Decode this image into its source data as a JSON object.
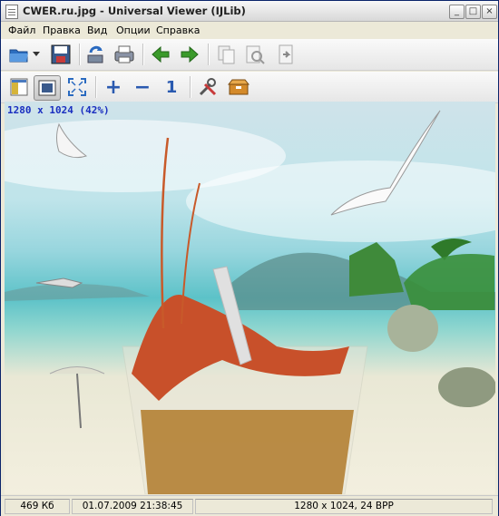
{
  "window": {
    "title": "CWER.ru.jpg - Universal Viewer (IJLib)"
  },
  "menu": [
    "Файл",
    "Правка",
    "Вид",
    "Опции",
    "Справка"
  ],
  "toolbar1": [
    "open-icon",
    "dropdown-arrow-icon",
    "save-icon",
    "reload-icon",
    "print-icon",
    "prev-icon",
    "next-icon",
    "copy-icon",
    "find-icon",
    "export-icon"
  ],
  "toolbar2": [
    "panel-icon",
    "fit-window-icon",
    "fullscreen-icon",
    "zoom-in-icon",
    "zoom-out-icon",
    "actual-size-icon",
    "settings-icon",
    "package-icon"
  ],
  "toolbar2_labels": {
    "zoom_in": "+",
    "zoom_out": "−",
    "actual": "1"
  },
  "viewport": {
    "image_info": "1280 x 1024 (42%)"
  },
  "status": {
    "filesize": "469 Кб",
    "date": "01.07.2009 21:38:45",
    "dimensions": "1280 x 1024, 24 BPP"
  },
  "colors": {
    "accent": "#1a2fc0",
    "arrow_green": "#3a9a2a"
  }
}
